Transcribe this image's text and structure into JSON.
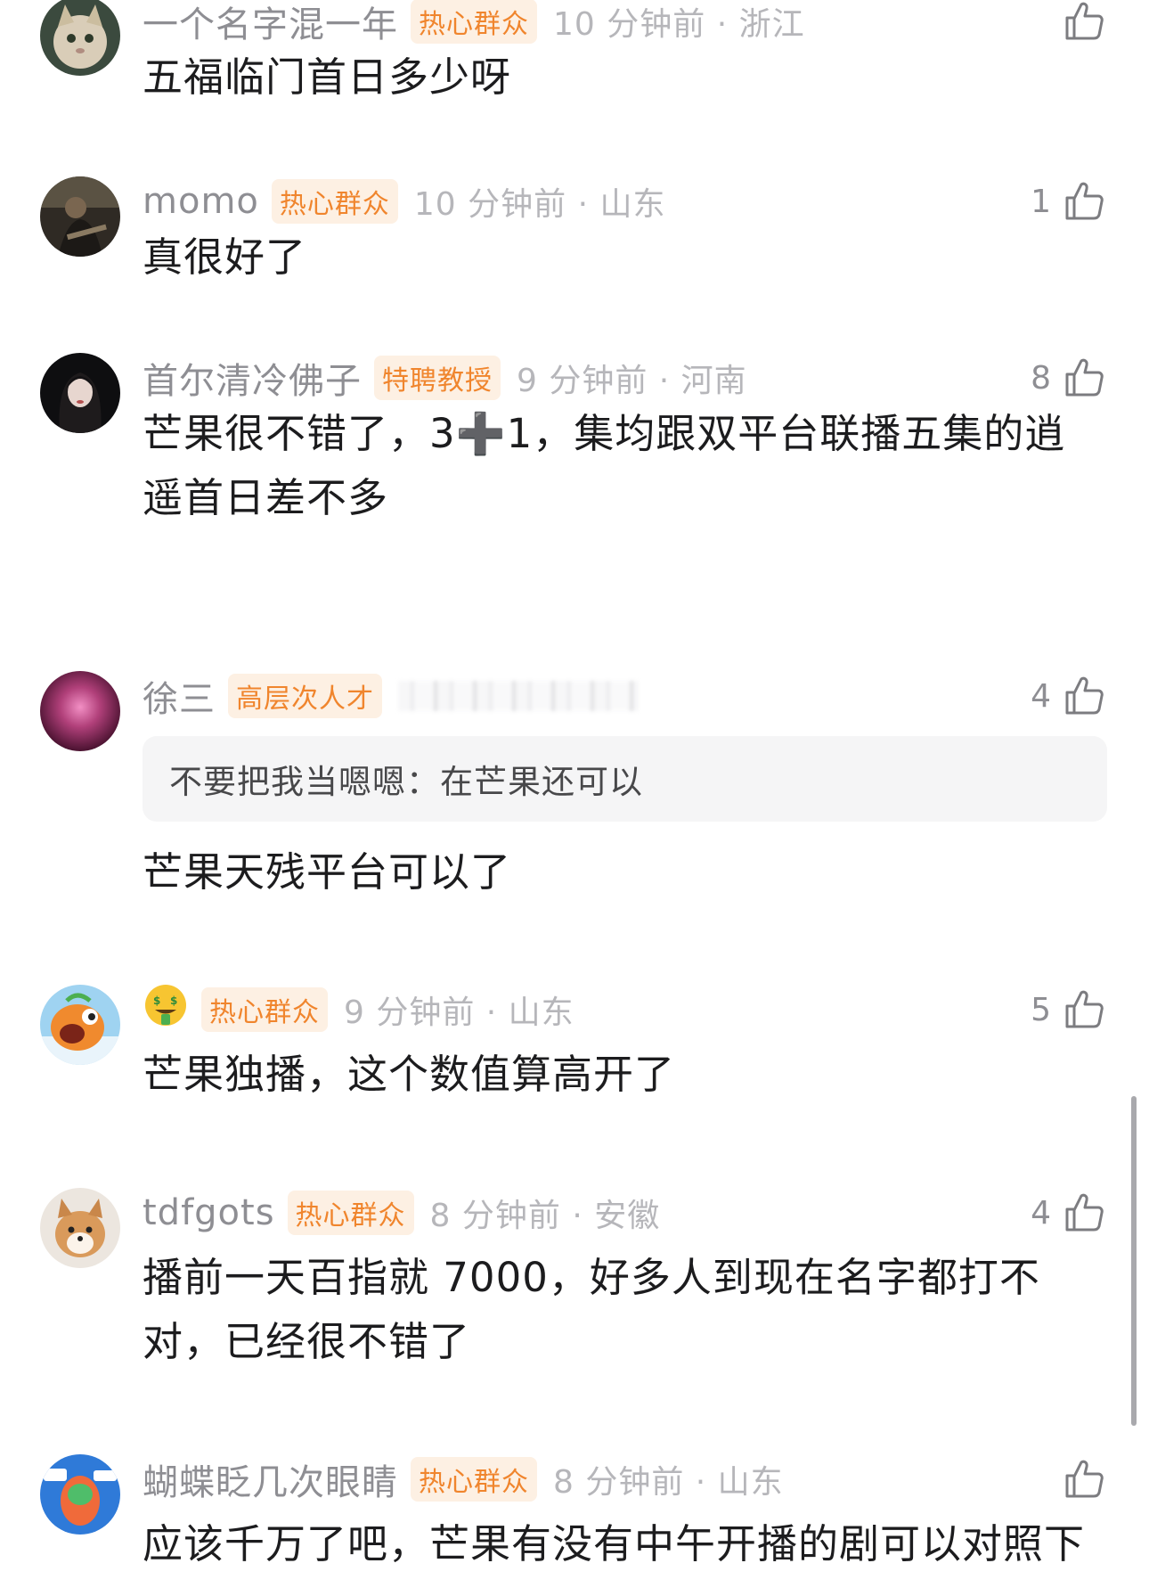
{
  "comments": [
    {
      "username": "一个名字混一年",
      "badge": "热心群众",
      "time_location": "10 分钟前 · 浙江",
      "likes": "",
      "content": "五福临门首日多少呀",
      "avatar_icon": "cat-avatar"
    },
    {
      "username": "momo",
      "badge": "热心群众",
      "time_location": "10 分钟前 · 山东",
      "likes": "1",
      "content": "真很好了",
      "avatar_icon": "guitar-photo-avatar"
    },
    {
      "username": "首尔清冷佛子",
      "badge": "特聘教授",
      "time_location": "9 分钟前 · 河南",
      "likes": "8",
      "content": "芒果很不错了，3➕1，集均跟双平台联播五集的逍遥首日差不多",
      "avatar_icon": "girl-portrait-avatar"
    },
    {
      "username": "徐三",
      "badge": "高层次人才",
      "time_location": "",
      "likes": "4",
      "quote": "不要把我当嗯嗯：在芒果还可以",
      "content": "芒果天残平台可以了",
      "avatar_icon": "pink-orb-avatar"
    },
    {
      "username": "",
      "badge": "热心群众",
      "time_location": "9 分钟前 · 山东",
      "likes": "5",
      "content": "芒果独播，这个数值算高开了",
      "avatar_icon": "cartoon-fish-avatar",
      "username_icon": "money-mouth-emoji-icon"
    },
    {
      "username": "tdfgots",
      "badge": "热心群众",
      "time_location": "8 分钟前 · 安徽",
      "likes": "4",
      "content": "播前一天百指就 7000，好多人到现在名字都打不对，已经很不错了",
      "avatar_icon": "shiba-dog-avatar"
    },
    {
      "username": "蝴蝶眨几次眼睛",
      "badge": "热心群众",
      "time_location": "8 分钟前 · 山东",
      "likes": "",
      "content": "应该千万了吧，芒果有没有中午开播的剧可以对照下",
      "avatar_icon": "cartoon-sticker-avatar"
    }
  ],
  "colors": {
    "badge_bg": "#fdf0e3",
    "badge_text": "#f0852d",
    "name": "#8e8e93",
    "time": "#b6b6ba",
    "content": "#1c1c1e"
  }
}
